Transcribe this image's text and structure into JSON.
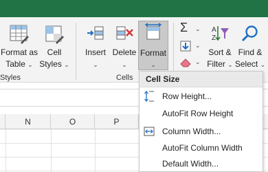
{
  "ribbon": {
    "format_as_table": {
      "line1": "Format as",
      "line2": "Table"
    },
    "cell_styles": {
      "line1": "Cell",
      "line2": "Styles"
    },
    "styles_group": "Styles",
    "insert": {
      "line1": "Insert"
    },
    "delete": {
      "line1": "Delete"
    },
    "format": {
      "line1": "Format"
    },
    "cells_group": "Cells",
    "sort_filter": {
      "line1": "Sort &",
      "line2": "Filter"
    },
    "find_select": {
      "line1": "Find &",
      "line2": "Select"
    }
  },
  "columns": [
    "N",
    "O",
    "P"
  ],
  "menu": {
    "header": "Cell Size",
    "items": [
      {
        "label": "Row Height...",
        "icon": "row-height-icon"
      },
      {
        "label": "AutoFit Row Height",
        "icon": ""
      },
      {
        "label": "Column Width...",
        "icon": "column-width-icon"
      },
      {
        "label": "AutoFit Column Width",
        "icon": ""
      },
      {
        "label": "Default Width...",
        "icon": ""
      }
    ]
  },
  "colors": {
    "title_bar": "#217346",
    "accent": "#1e6fc5",
    "delete_x": "#d13438",
    "sort_arrow": "#2e7d32"
  }
}
